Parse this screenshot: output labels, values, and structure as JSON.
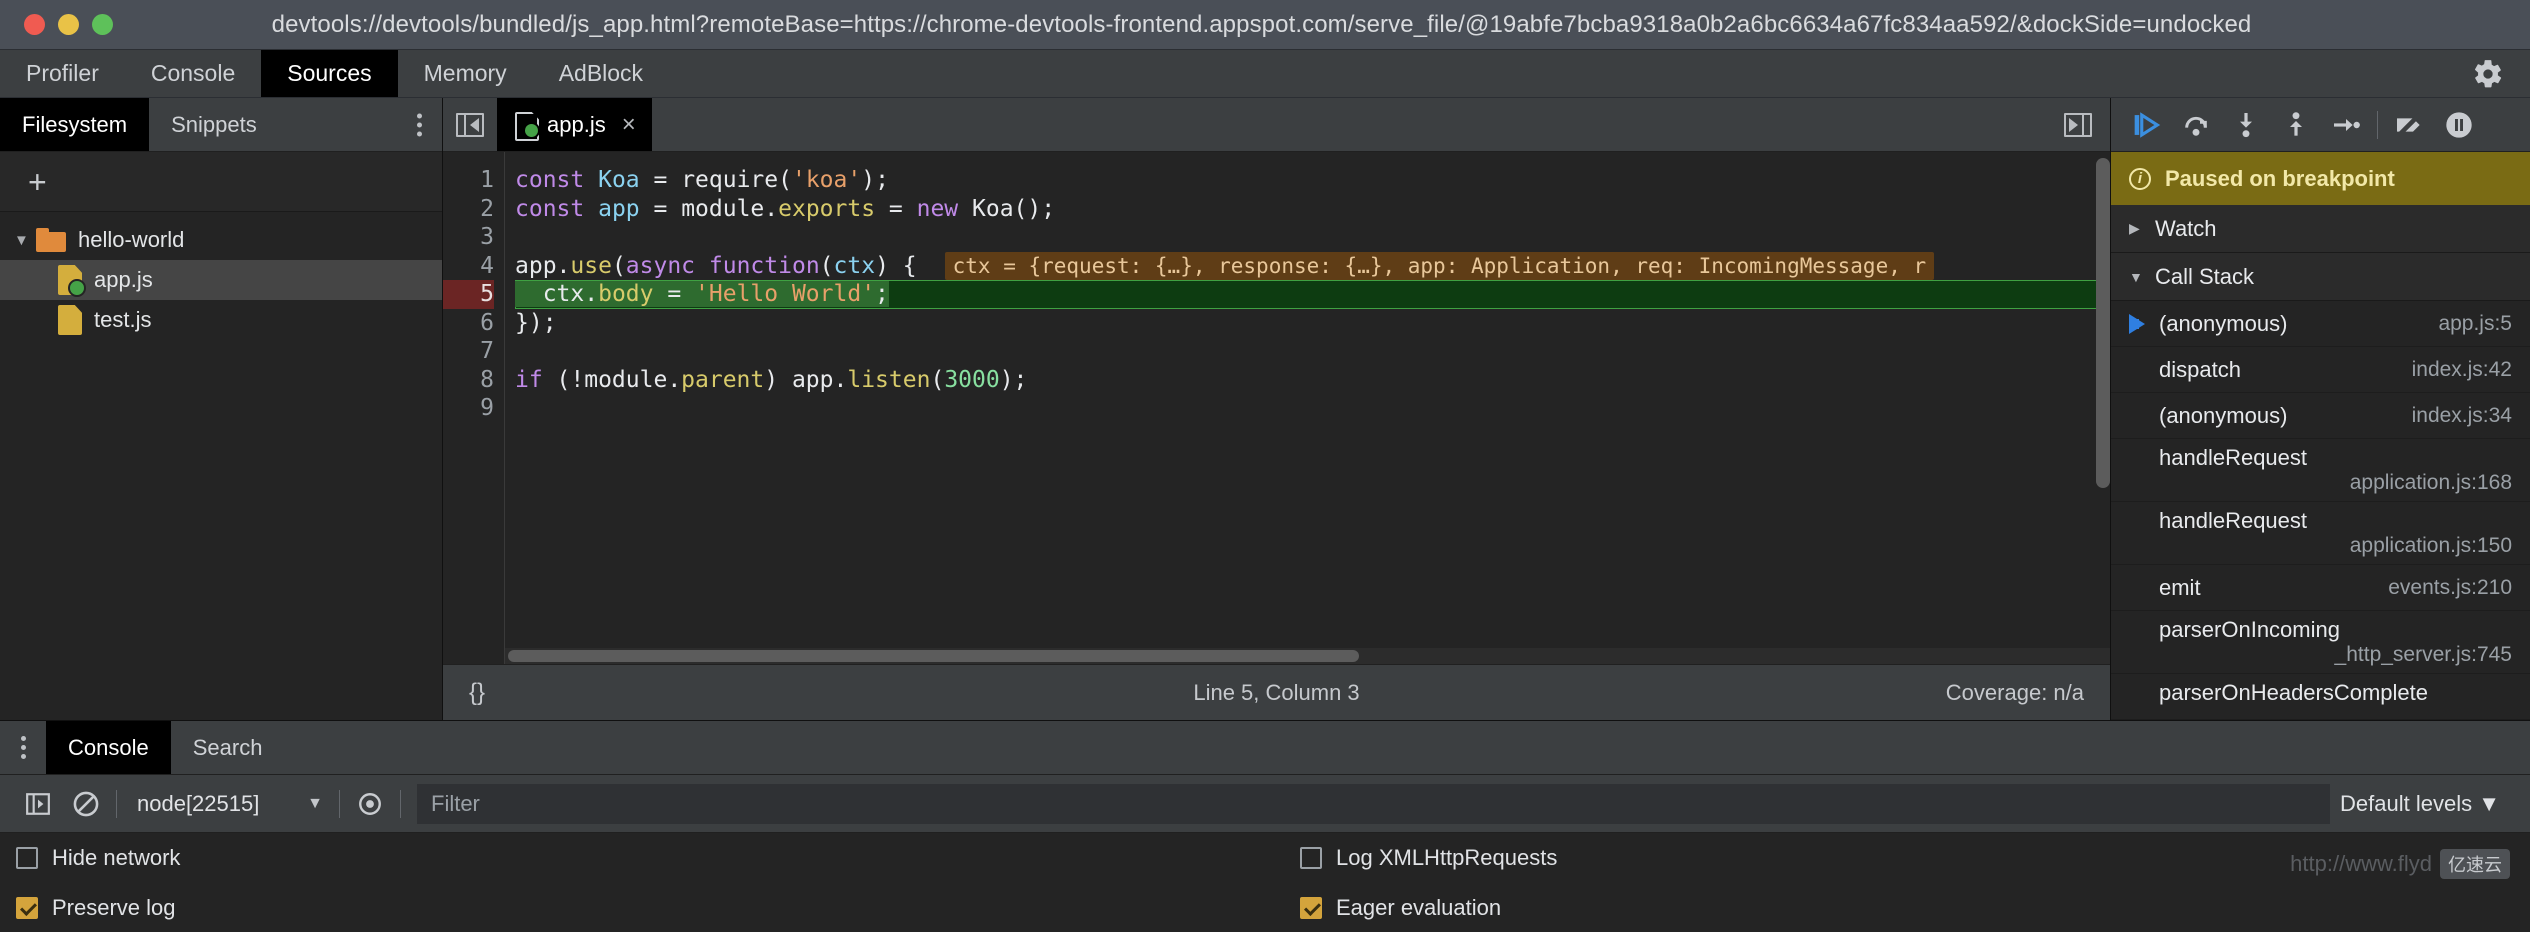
{
  "titlebar": {
    "url": "devtools://devtools/bundled/js_app.html?remoteBase=https://chrome-devtools-frontend.appspot.com/serve_file/@19abfe7bcba9318a0b2a6bc6634a67fc834aa592/&dockSide=undocked",
    "traffic": {
      "close": "close-button",
      "minimize": "minimize-button",
      "zoom": "zoom-button"
    }
  },
  "main_tabs": [
    {
      "label": "Profiler",
      "active": false
    },
    {
      "label": "Console",
      "active": false
    },
    {
      "label": "Sources",
      "active": true
    },
    {
      "label": "Memory",
      "active": false
    },
    {
      "label": "AdBlock",
      "active": false
    }
  ],
  "settings_icon": "gear-icon",
  "navigator": {
    "tabs": [
      {
        "label": "Filesystem",
        "active": true
      },
      {
        "label": "Snippets",
        "active": false
      }
    ],
    "more_options": "kebab-menu-icon",
    "add_label": "+",
    "tree": [
      {
        "type": "folder",
        "label": "hello-world",
        "expanded": true,
        "selected": false
      },
      {
        "type": "file",
        "label": "app.js",
        "mapped": true,
        "selected": true
      },
      {
        "type": "file",
        "label": "test.js",
        "mapped": false,
        "selected": false
      }
    ]
  },
  "editor": {
    "collapse_sidebar": "collapse-sidebar-icon",
    "expand_sidebar": "expand-sidebar-icon",
    "tab": {
      "label": "app.js",
      "close": "×",
      "mapped": true
    },
    "lines": [
      {
        "n": "1",
        "segments": [
          {
            "t": "const ",
            "c": "kw"
          },
          {
            "t": "Koa",
            "c": "var"
          },
          {
            "t": " = ",
            "c": "pl"
          },
          {
            "t": "require",
            "c": "pl"
          },
          {
            "t": "(",
            "c": "pl"
          },
          {
            "t": "'koa'",
            "c": "str"
          },
          {
            "t": ");",
            "c": "pl"
          }
        ]
      },
      {
        "n": "2",
        "segments": [
          {
            "t": "const ",
            "c": "kw"
          },
          {
            "t": "app",
            "c": "var"
          },
          {
            "t": " = ",
            "c": "pl"
          },
          {
            "t": "module.",
            "c": "pl"
          },
          {
            "t": "exports",
            "c": "prop"
          },
          {
            "t": " = ",
            "c": "pl"
          },
          {
            "t": "new ",
            "c": "kw"
          },
          {
            "t": "Koa();",
            "c": "pl"
          }
        ]
      },
      {
        "n": "3",
        "segments": []
      },
      {
        "n": "4",
        "segments": [
          {
            "t": "app.",
            "c": "pl"
          },
          {
            "t": "use",
            "c": "fn"
          },
          {
            "t": "(",
            "c": "pl"
          },
          {
            "t": "async ",
            "c": "kw"
          },
          {
            "t": "function",
            "c": "kw"
          },
          {
            "t": "(",
            "c": "pl"
          },
          {
            "t": "ctx",
            "c": "var"
          },
          {
            "t": ") {",
            "c": "pl"
          }
        ],
        "inline_eval": "ctx = {request: {…}, response: {…}, app: Application, req: IncomingMessage, r"
      },
      {
        "n": "5",
        "breakpoint": true,
        "executing": true,
        "segments": [
          {
            "t": "  ctx.",
            "c": "pl"
          },
          {
            "t": "body",
            "c": "prop"
          },
          {
            "t": " = ",
            "c": "pl"
          },
          {
            "t": "'Hello World'",
            "c": "str"
          },
          {
            "t": ";",
            "c": "pl"
          }
        ]
      },
      {
        "n": "6",
        "segments": [
          {
            "t": "});",
            "c": "pl"
          }
        ]
      },
      {
        "n": "7",
        "segments": []
      },
      {
        "n": "8",
        "segments": [
          {
            "t": "if ",
            "c": "kw"
          },
          {
            "t": "(!module.",
            "c": "pl"
          },
          {
            "t": "parent",
            "c": "prop"
          },
          {
            "t": ") app.",
            "c": "pl"
          },
          {
            "t": "listen",
            "c": "fn"
          },
          {
            "t": "(",
            "c": "pl"
          },
          {
            "t": "3000",
            "c": "num"
          },
          {
            "t": ");",
            "c": "pl"
          }
        ]
      },
      {
        "n": "9",
        "segments": []
      }
    ],
    "status": {
      "format_label": "{}",
      "position": "Line 5, Column 3",
      "coverage": "Coverage: n/a"
    }
  },
  "debugger": {
    "toolbar": [
      {
        "name": "resume-script-execution",
        "icon": "resume-icon",
        "active": true
      },
      {
        "name": "step-over-next-function-call",
        "icon": "step-over-icon",
        "active": false
      },
      {
        "name": "step-into-next-function-call",
        "icon": "step-into-icon",
        "active": false
      },
      {
        "name": "step-out-of-current-function",
        "icon": "step-out-icon",
        "active": false
      },
      {
        "name": "step",
        "icon": "step-icon",
        "active": false
      },
      {
        "name": "deactivate-breakpoints",
        "icon": "deactivate-breakpoints-icon",
        "active": false
      },
      {
        "name": "pause-on-exceptions",
        "icon": "pause-on-exceptions-icon",
        "active": false
      }
    ],
    "paused_banner": {
      "icon": "info-icon",
      "text": "Paused on breakpoint"
    },
    "sections": [
      {
        "label": "Watch",
        "expanded": false
      },
      {
        "label": "Call Stack",
        "expanded": true
      }
    ],
    "call_stack": [
      {
        "name": "(anonymous)",
        "location": "app.js:5",
        "selected": true,
        "wrapped": false
      },
      {
        "name": "dispatch",
        "location": "index.js:42",
        "selected": false,
        "wrapped": false
      },
      {
        "name": "(anonymous)",
        "location": "index.js:34",
        "selected": false,
        "wrapped": false
      },
      {
        "name": "handleRequest",
        "location": "application.js:168",
        "selected": false,
        "wrapped": true
      },
      {
        "name": "handleRequest",
        "location": "application.js:150",
        "selected": false,
        "wrapped": true
      },
      {
        "name": "emit",
        "location": "events.js:210",
        "selected": false,
        "wrapped": false
      },
      {
        "name": "parserOnIncoming",
        "location": "_http_server.js:745",
        "selected": false,
        "wrapped": true
      },
      {
        "name": "parserOnHeadersComplete",
        "location": "",
        "selected": false,
        "wrapped": true
      }
    ]
  },
  "drawer": {
    "more_options": "kebab-menu-icon",
    "tabs": [
      {
        "label": "Console",
        "active": true
      },
      {
        "label": "Search",
        "active": false
      }
    ],
    "toolbar": {
      "sidebar_toggle": "console-sidebar-icon",
      "clear_console": "clear-console-icon",
      "context": "node[22515]",
      "context_chevron": "▼",
      "eye": "live-expression-icon",
      "filter_placeholder": "Filter",
      "filter_value": "",
      "levels": "Default levels ▼"
    },
    "settings": [
      {
        "label": "Hide network",
        "checked": false
      },
      {
        "label": "Log XMLHttpRequests",
        "checked": false
      },
      {
        "label": "Preserve log",
        "checked": true
      },
      {
        "label": "Eager evaluation",
        "checked": true
      }
    ]
  },
  "watermark": {
    "text": "http://www.flyd",
    "badge": "亿速云"
  },
  "colors": {
    "accent_blue": "#2f7fe0",
    "breakpoint_red": "#e2483d",
    "exec_green": "#0d3c11",
    "paused_yellow": "#7a6b14",
    "folder_orange": "#e08a3c",
    "file_yellow": "#d4ae3d",
    "checkbox_checked": "#d4a43c"
  }
}
